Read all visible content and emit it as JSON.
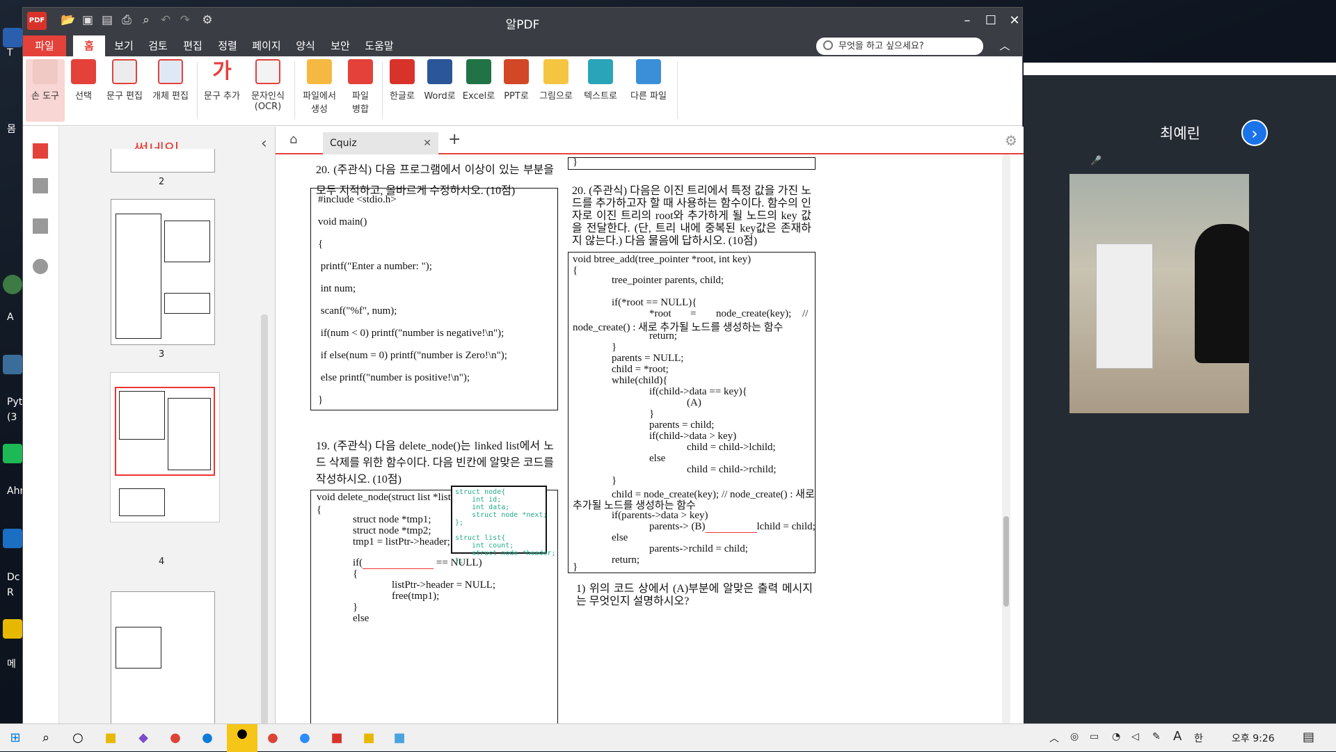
{
  "app": {
    "title": "알PDF",
    "logo_text": "PDF"
  },
  "menu": {
    "tabs": [
      "파일",
      "홈",
      "보기",
      "검토",
      "편집",
      "정렬",
      "페이지",
      "양식",
      "보안",
      "도움말"
    ],
    "search_placeholder": "무엇을 하고 싶으세요?"
  },
  "ribbon": {
    "items": [
      {
        "label": "손 도구",
        "icon": "hand-icon"
      },
      {
        "label": "선택",
        "icon": "select-icon"
      },
      {
        "label": "문구 편집",
        "icon": "text-edit-icon"
      },
      {
        "label": "개체 편집",
        "icon": "object-edit-icon"
      },
      {
        "label": "문구 추가",
        "icon": "add-text-icon"
      },
      {
        "label": "문자인식\n(OCR)",
        "icon": "ocr-icon"
      },
      {
        "label": "파일에서\n생성",
        "icon": "create-from-file-icon"
      },
      {
        "label": "파일\n병합",
        "icon": "merge-icon"
      },
      {
        "label": "한글로",
        "icon": "hwp-icon"
      },
      {
        "label": "Word로",
        "icon": "word-icon"
      },
      {
        "label": "Excel로",
        "icon": "excel-icon"
      },
      {
        "label": "PPT로",
        "icon": "ppt-icon"
      },
      {
        "label": "그림으로",
        "icon": "image-icon"
      },
      {
        "label": "텍스트로",
        "icon": "text-icon"
      },
      {
        "label": "다른 파일",
        "icon": "other-file-icon"
      }
    ]
  },
  "colors": {
    "accent": "#e4413b",
    "titlebar": "#3a3d44",
    "zoom_blue": "#1a73e8"
  },
  "thumbnails": {
    "title": "썸네일",
    "pages": [
      "2",
      "3",
      "4"
    ]
  },
  "doc": {
    "tab_name": "Cquiz"
  },
  "content": {
    "q20a_title": "20. (주관식) 다음 프로그램에서 이상이 있는 부분을 모두 지적하고, 올바르게 수정하시오. (10점)",
    "code1": [
      "#include <stdio.h>",
      "void main()",
      "{",
      " printf(\"Enter a number: \");",
      " int num;",
      " scanf(\"%f\", num);",
      " if(num < 0) printf(\"number is negative!\\n\");",
      " if else(num = 0) printf(\"number is Zero!\\n\");",
      " else printf(\"number is positive!\\n\");",
      "}"
    ],
    "q19_title": "19. (주관식) 다음 delete_node()는 linked list에서 노드 삭제를 위한 함수이다. 다음 빈칸에 알맞은 코드를 작성하시오. (10점)",
    "code2": [
      "void delete_node(struct list *listPtr)",
      "{",
      "struct node *tmp1;",
      "struct node *tmp2;",
      "tmp1 = listPtr->header;",
      "if(",
      "== NULL)",
      "{",
      "listPtr->header = NULL;",
      "free(tmp1);",
      "}",
      "else"
    ],
    "inset": "struct node{\n    int id;\n    int data;\n    struct node *next;\n};\n\nstruct list{\n    int count;\n    struct node *header;\n};",
    "top_bracket": "}",
    "q20b_title": "20. (주관식) 다음은 이진 트리에서 특정 값을 가진 노드를 추가하고자 할 때 사용하는 함수이다. 함수의 인자로 이진 트리의 root와 추가하게 될 노드의 key 값을 전달한다. (단, 트리 내에 중복된 key값은 존재하지 않는다.) 다음 물음에 답하시오. (10점)",
    "code3": [
      "void btree_add(tree_pointer *root, int key)",
      "{",
      "tree_pointer parents, child;",
      "if(*root == NULL){",
      "*root",
      "=",
      "node_create(key);",
      "//",
      "node_create() : 새로 추가될 노드를 생성하는 함수",
      "return;",
      "}",
      "parents = NULL;",
      "child = *root;",
      "while(child){",
      "if(child->data == key){",
      "(A)",
      "}",
      "parents = child;",
      "if(child->data > key)",
      "child = child->lchild;",
      "else",
      "child = child->rchild;",
      "}",
      "child = node_create(key); // node_create() : 새로",
      "추가될 노드를 생성하는 함수",
      "if(parents->data > key)",
      "parents-> (B)",
      "lchild = child;",
      "else",
      "parents->rchild = child;",
      "return;",
      "}"
    ],
    "q20b_sub1": "1)  위의 코드 상에서 (A)부분에 알맞은 출력 메시지는 무엇인지 설명하시오?"
  },
  "zoom": {
    "participant": "최예린"
  },
  "taskbar": {
    "time": "오후 9:26",
    "ime": "한",
    "font_icon": "A"
  },
  "desktop": {
    "labels": [
      "T",
      "몸",
      "A",
      "Pyt",
      "(3",
      "Ahn",
      "Dc",
      "R",
      "메"
    ]
  }
}
